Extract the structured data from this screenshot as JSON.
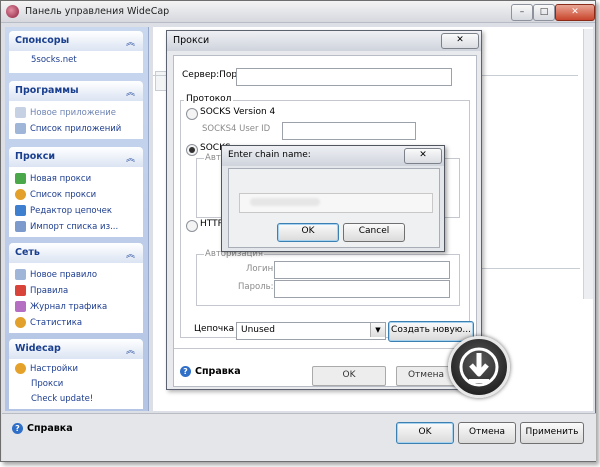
{
  "window": {
    "title": "Панель управления WideCap"
  },
  "sidebar": {
    "groups": [
      {
        "title": "Спонсоры",
        "items": [
          "5socks.net"
        ]
      },
      {
        "title": "Программы",
        "items": [
          "Новое приложение",
          "Список приложений"
        ]
      },
      {
        "title": "Прокси",
        "items": [
          "Новая прокси",
          "Список прокси",
          "Редактор цепочек",
          "Импорт списка из..."
        ]
      },
      {
        "title": "Сеть",
        "items": [
          "Новое правило",
          "Правила",
          "Журнал трафика",
          "Статистика"
        ]
      },
      {
        "title": "Widecap",
        "items": [
          "Настройки",
          "Прокси",
          "Check update!"
        ]
      }
    ]
  },
  "bottom": {
    "help": "Справка",
    "ok": "OK",
    "cancel": "Отмена",
    "apply": "Применить"
  },
  "proxy_dialog": {
    "title": "Прокси",
    "server_port_label": "Сервер:Порт",
    "protocol_label": "Протокол",
    "socks4": "SOCKS Version 4",
    "socks4_userid": "SOCKS4 User ID",
    "socks5_partial": "SOCKS",
    "auto_partial": "Авто",
    "http": "HTTP",
    "auth_partial": "Авторизация",
    "login_label": "Логин:",
    "password_label": "Пароль:",
    "chain_label": "Цепочка",
    "chain_value": "Unused",
    "create_new": "Создать новую...",
    "help": "Справка",
    "ghost_ok": "OK",
    "ghost_cancel": "Отмена"
  },
  "chain_dialog": {
    "title": "Enter chain name:",
    "ok": "OK",
    "cancel": "Cancel"
  },
  "colors": {
    "sidebar_header_text": "#1a3f8e",
    "sidebar_bg": "#b3c4e4",
    "close_button": "#c9452c"
  }
}
